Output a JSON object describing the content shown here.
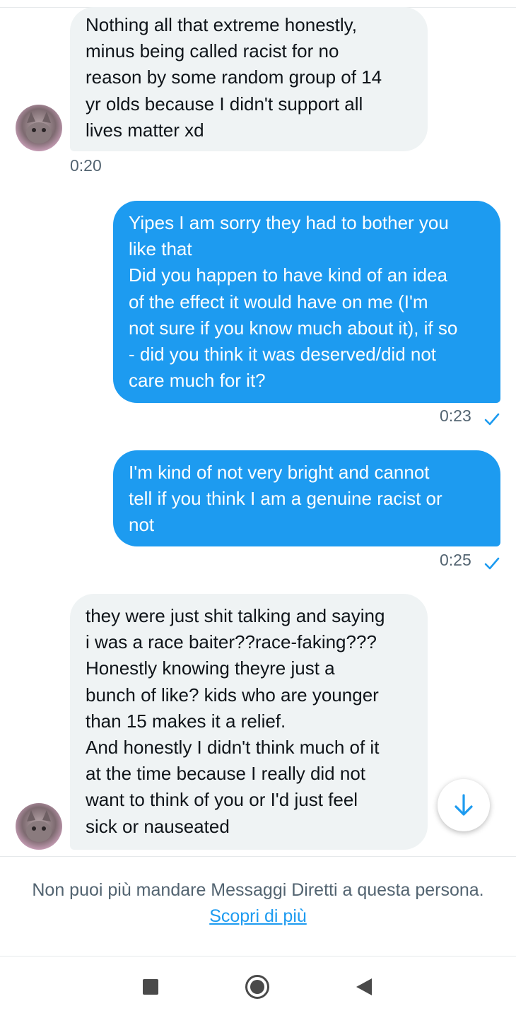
{
  "conversation": {
    "messages": [
      {
        "direction": "incoming",
        "text": "Nothing all that extreme honestly,\nminus being called racist for no\nreason by some random group of 14\nyr olds because I didn't support all\nlives matter xd",
        "time": "0:20"
      },
      {
        "direction": "outgoing",
        "text": "Yipes I am sorry they had to bother you\nlike that\nDid you happen to have kind of an idea\nof the effect it would have on me (I'm\nnot sure if you know much about it), if so\n- did you think it was deserved/did not\ncare much for it?",
        "time": "0:23",
        "status": "sent"
      },
      {
        "direction": "outgoing",
        "text": "I'm kind of not very bright and cannot\ntell if you think I am a genuine racist or\nnot",
        "time": "0:25",
        "status": "sent"
      },
      {
        "direction": "incoming",
        "text": "they were just shit talking and saying\ni was a race baiter??race-faking???\nHonestly knowing theyre just a\nbunch of like? kids who are younger\nthan 15 makes it a relief.\nAnd honestly I didn't think much of it\nat the time because I really did not\nwant to think of you or I'd just feel\nsick or nauseated"
      }
    ]
  },
  "footer": {
    "notice": "Non puoi più mandare Messaggi Diretti a questa persona.",
    "link": "Scopri di più"
  },
  "colors": {
    "accent": "#1d9bf0",
    "incoming_bubble": "#eff3f4",
    "muted_text": "#536471"
  },
  "icons": {
    "scroll_down": "arrow-down-icon",
    "read_receipt": "checkmark-icon",
    "nav": [
      "square-recents-icon",
      "circle-home-icon",
      "triangle-back-icon"
    ]
  }
}
